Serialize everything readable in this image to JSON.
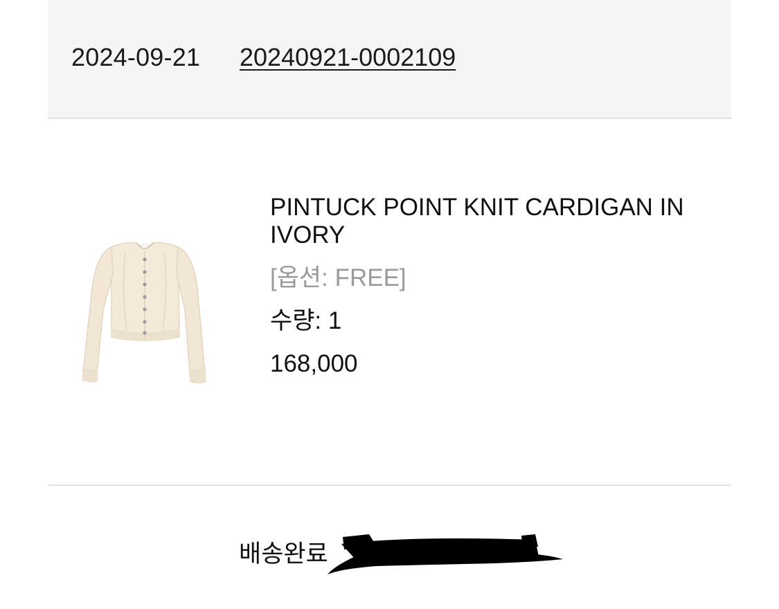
{
  "order": {
    "date": "2024-09-21",
    "number": "20240921-0002109"
  },
  "product": {
    "name": "PINTUCK POINT KNIT CARDIGAN IN IVORY",
    "option": "[옵션: FREE]",
    "quantity": "수량: 1",
    "price": "168,000",
    "image_icon": "cardigan-photo"
  },
  "delivery": {
    "status": "배송완료"
  },
  "colors": {
    "header_bg": "#f5f5f5",
    "divider": "#e2e2e2",
    "option_text": "#9a9a9a",
    "cardigan": "#f3ead9"
  }
}
